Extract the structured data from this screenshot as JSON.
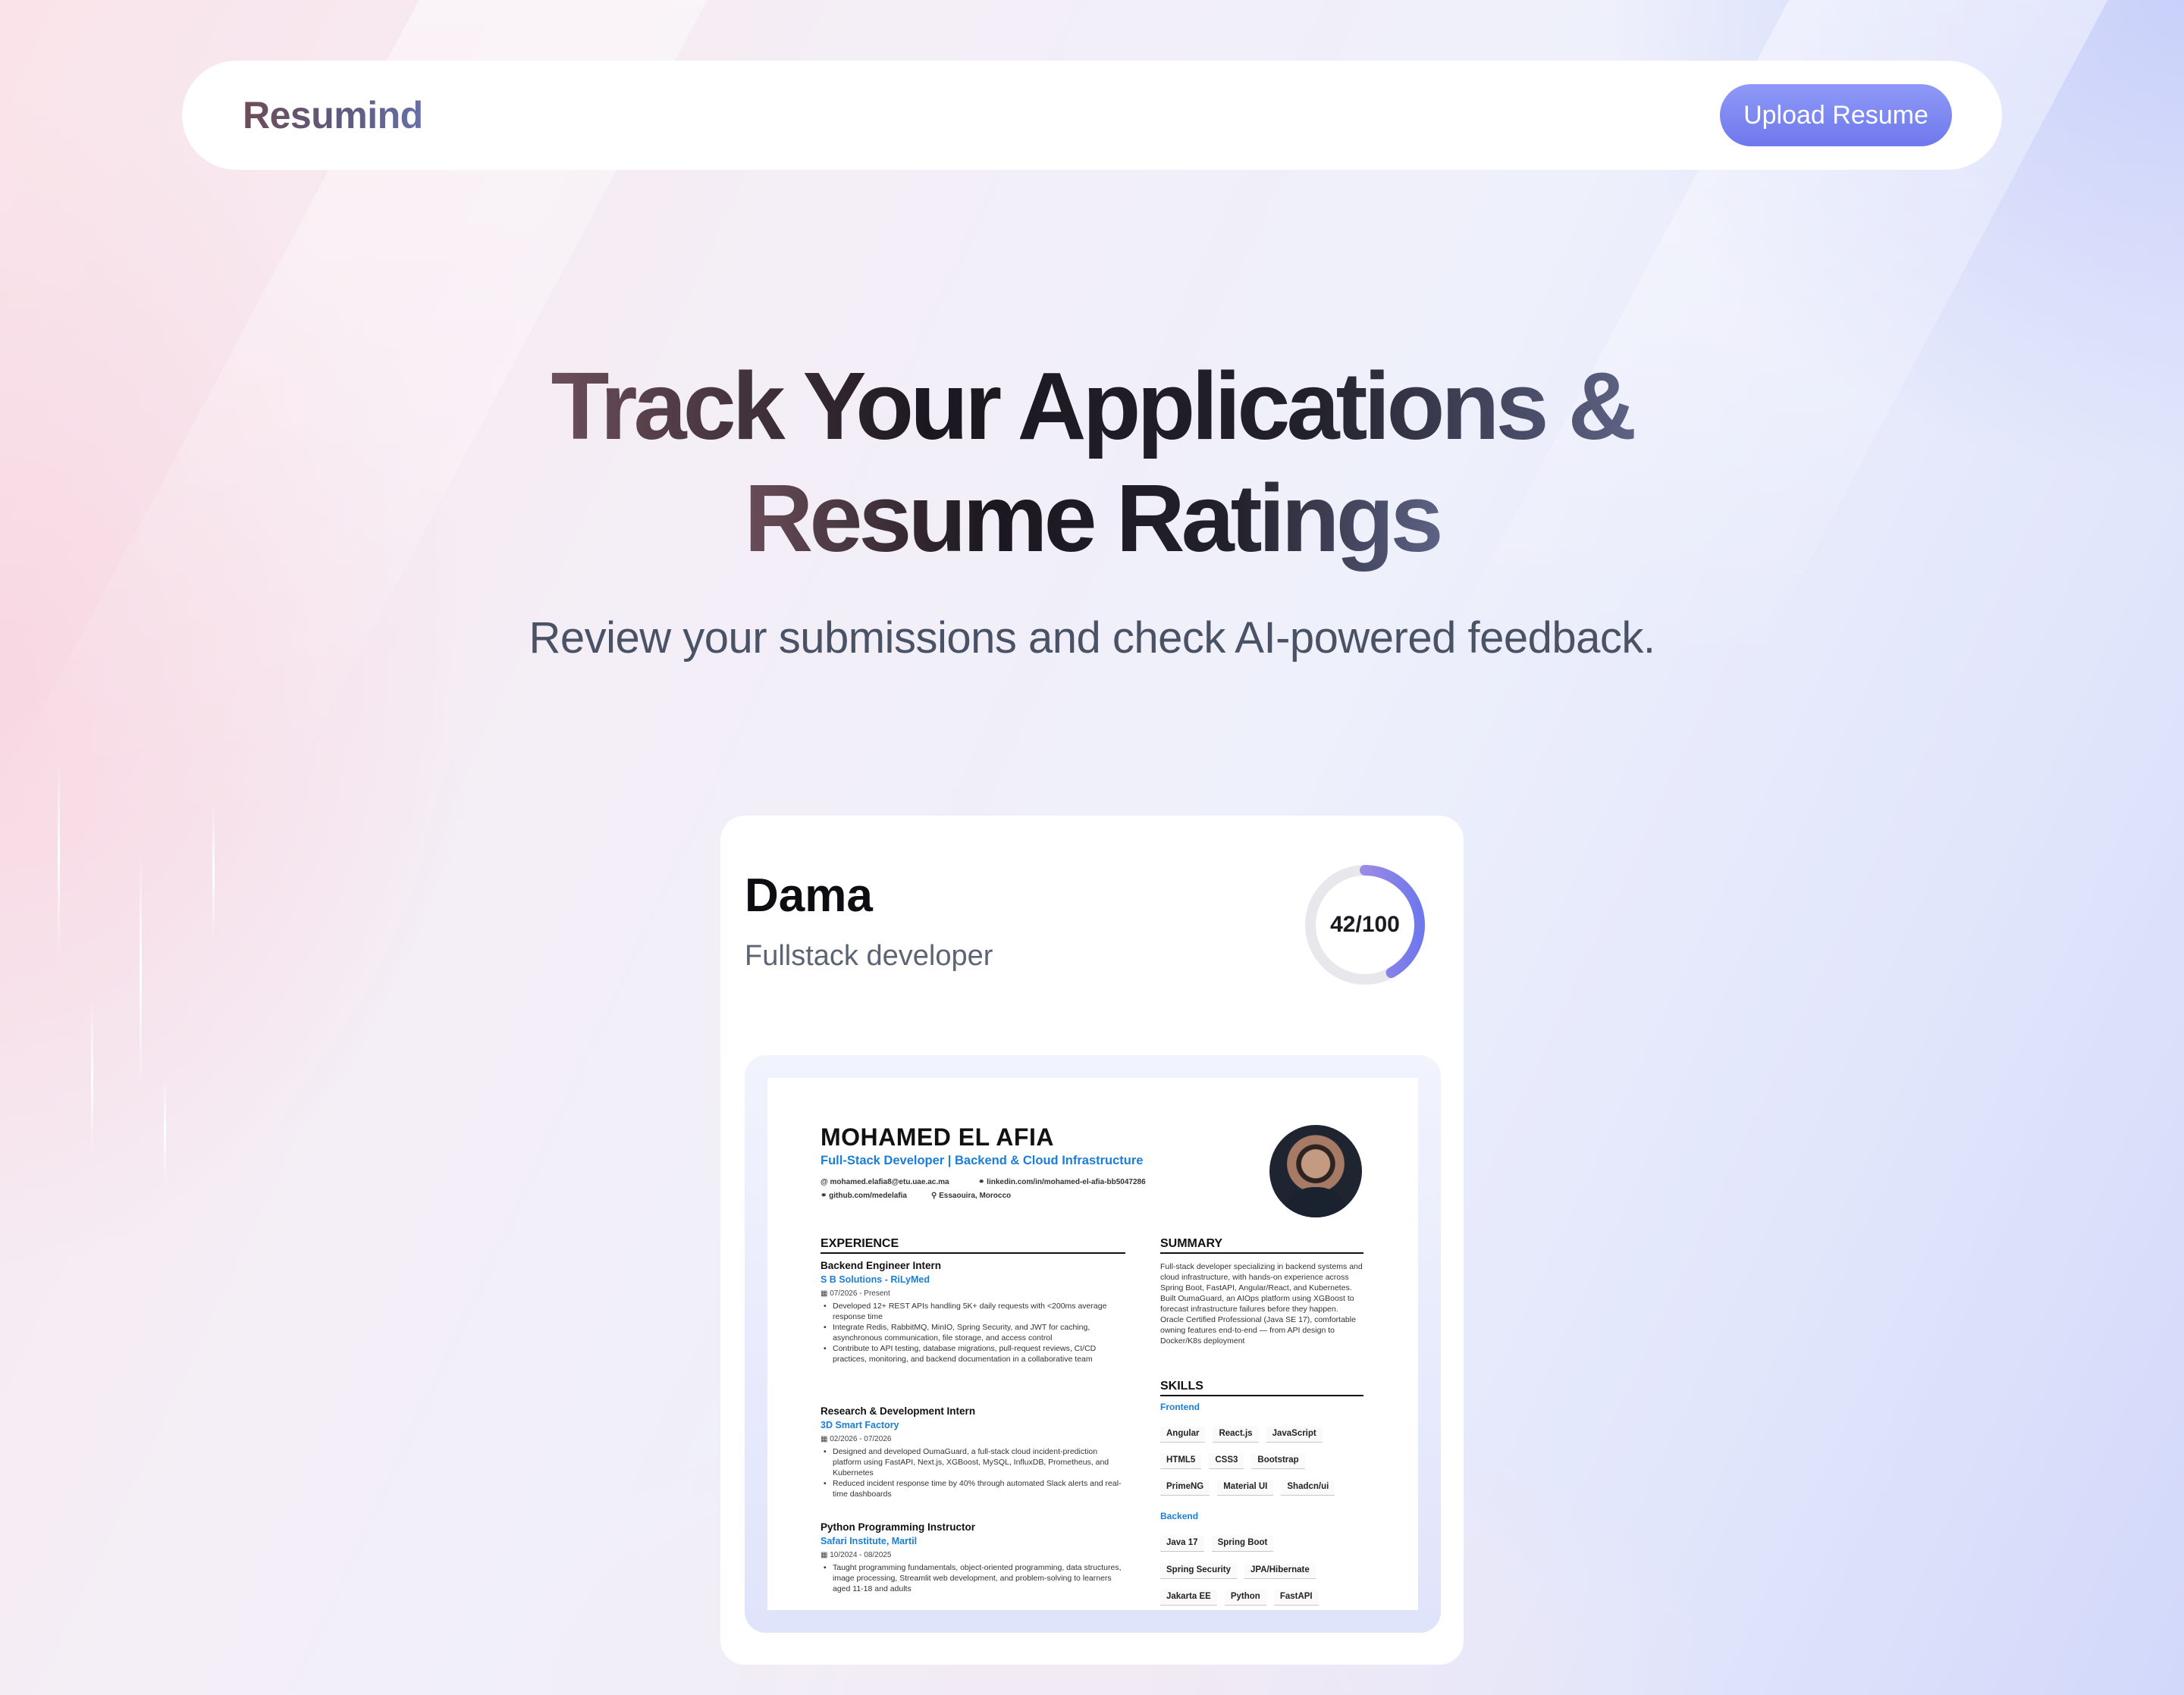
{
  "navbar": {
    "logo": "Resumind",
    "upload_button": "Upload Resume"
  },
  "hero": {
    "title_line1": "Track Your Applications &",
    "title_line2": "Resume Ratings",
    "subtitle": "Review your submissions and check AI-powered feedback."
  },
  "card": {
    "company": "Dama",
    "job_title": "Fullstack developer",
    "score_text": "42/100",
    "score_value": 42,
    "score_max": 100,
    "ring_colors": {
      "track": "#e8e8ec",
      "start": "#c89adf",
      "end": "#6f78ec"
    }
  },
  "resume": {
    "name": "MOHAMED EL AFIA",
    "headline": "Full-Stack Developer | Backend & Cloud Infrastructure",
    "contact": {
      "email": "mohamed.elafia8@etu.uae.ac.ma",
      "linkedin": "linkedin.com/in/mohamed-el-afia-bb5047286",
      "github": "github.com/medelafia",
      "location": "Essaouira, Morocco"
    },
    "sections": {
      "experience": "EXPERIENCE",
      "summary": "SUMMARY",
      "skills": "SKILLS"
    },
    "experience": [
      {
        "role": "Backend Engineer Intern",
        "company": "S B Solutions - RiLyMed",
        "dates": "07/2026 - Present",
        "bullets": [
          "Developed 12+ REST APIs handling 5K+ daily requests with <200ms average response time",
          "Integrate Redis, RabbitMQ, MinIO, Spring Security, and JWT for caching, asynchronous communication, file storage, and access control",
          "Contribute to API testing, database migrations, pull-request reviews, CI/CD practices, monitoring, and backend documentation in a collaborative team"
        ]
      },
      {
        "role": "Research & Development Intern",
        "company": "3D Smart Factory",
        "dates": "02/2026 - 07/2026",
        "bullets": [
          "Designed and developed OumaGuard, a full-stack cloud incident-prediction platform using FastAPI, Next.js, XGBoost, MySQL, InfluxDB, Prometheus, and Kubernetes",
          "Reduced incident response time by 40% through automated Slack alerts and real-time dashboards"
        ]
      },
      {
        "role": "Python Programming Instructor",
        "company": "Safari Institute, Martil",
        "dates": "10/2024 - 08/2025",
        "bullets": [
          "Taught programming fundamentals, object-oriented programming, data structures, image processing, Streamlit web development, and problem-solving to learners aged 11-18 and adults"
        ]
      }
    ],
    "summary_text": "Full-stack developer specializing in backend systems and cloud infrastructure, with hands-on experience across Spring Boot, FastAPI, Angular/React, and Kubernetes. Built OumaGuard, an AIOps platform using XGBoost to forecast infrastructure failures before they happen. Oracle Certified Professional (Java SE 17), comfortable owning features end-to-end — from API design to Docker/K8s deployment",
    "skills": {
      "frontend_label": "Frontend",
      "frontend_rows": [
        [
          "Angular",
          "React.js",
          "JavaScript"
        ],
        [
          "HTML5",
          "CSS3",
          "Bootstrap"
        ],
        [
          "PrimeNG",
          "Material UI",
          "Shadcn/ui"
        ]
      ],
      "backend_label": "Backend",
      "backend_rows": [
        [
          "Java 17",
          "Spring Boot"
        ],
        [
          "Spring Security",
          "JPA/Hibernate"
        ],
        [
          "Jakarta EE",
          "Python",
          "FastAPI"
        ]
      ]
    }
  }
}
